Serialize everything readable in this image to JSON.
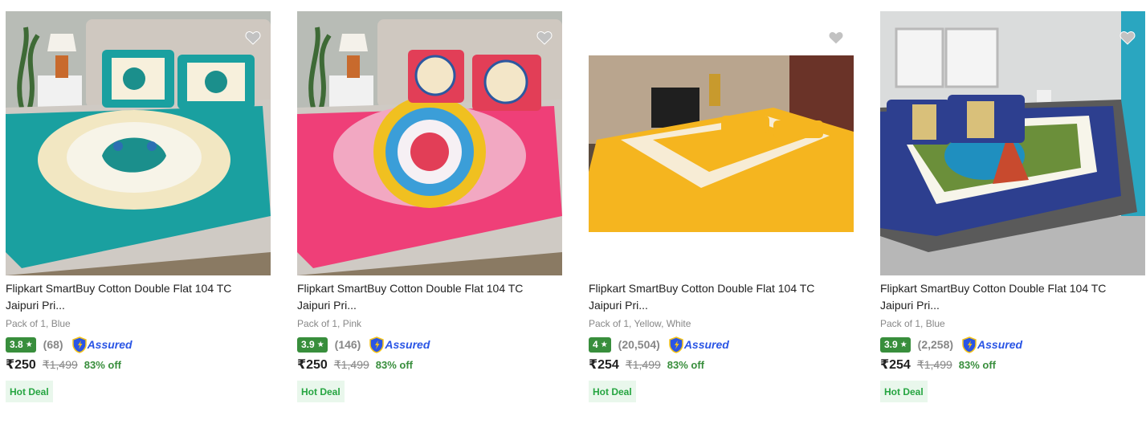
{
  "products": [
    {
      "title_line1": "Flipkart SmartBuy Cotton Double Flat 104 TC",
      "title_line2": "Jaipuri Pri...",
      "variant": "Pack of 1, Blue",
      "rating": "3.8",
      "rating_count": "(68)",
      "assured": "Assured",
      "price": "₹250",
      "mrp": "₹1,499",
      "discount": "83% off",
      "deal": "Hot Deal",
      "sheet_color": "#1aa0a0",
      "image_alt": "teal peacock print bedsheet"
    },
    {
      "title_line1": "Flipkart SmartBuy Cotton Double Flat 104 TC",
      "title_line2": "Jaipuri Pri...",
      "variant": "Pack of 1, Pink",
      "rating": "3.9",
      "rating_count": "(146)",
      "assured": "Assured",
      "price": "₹250",
      "mrp": "₹1,499",
      "discount": "83% off",
      "deal": "Hot Deal",
      "sheet_color": "#ef3f78",
      "image_alt": "pink mandala print bedsheet"
    },
    {
      "title_line1": "Flipkart SmartBuy Cotton Double Flat 104 TC",
      "title_line2": "Jaipuri Pri...",
      "variant": "Pack of 1, Yellow, White",
      "rating": "4",
      "rating_count": "(20,504)",
      "assured": "Assured",
      "price": "₹254",
      "mrp": "₹1,499",
      "discount": "83% off",
      "deal": "Hot Deal",
      "sheet_color": "#f5b51f",
      "image_alt": "yellow floral border bedsheet"
    },
    {
      "title_line1": "Flipkart SmartBuy Cotton Double Flat 104 TC",
      "title_line2": "Jaipuri Pri...",
      "variant": "Pack of 1, Blue",
      "rating": "3.9",
      "rating_count": "(2,258)",
      "assured": "Assured",
      "price": "₹254",
      "mrp": "₹1,499",
      "discount": "83% off",
      "deal": "Hot Deal",
      "sheet_color": "#2d3f8f",
      "image_alt": "blue jaipuri print bedsheet"
    }
  ],
  "icons": {
    "wishlist": "heart-icon",
    "rating_star": "star-icon",
    "assured": "assured-shield-icon"
  },
  "colors": {
    "rating_green": "#388e3c",
    "assured_blue": "#2a55e5",
    "discount_green": "#388e3c",
    "hot_deal_bg": "#e9f7ec",
    "hot_deal_text": "#26a541"
  }
}
